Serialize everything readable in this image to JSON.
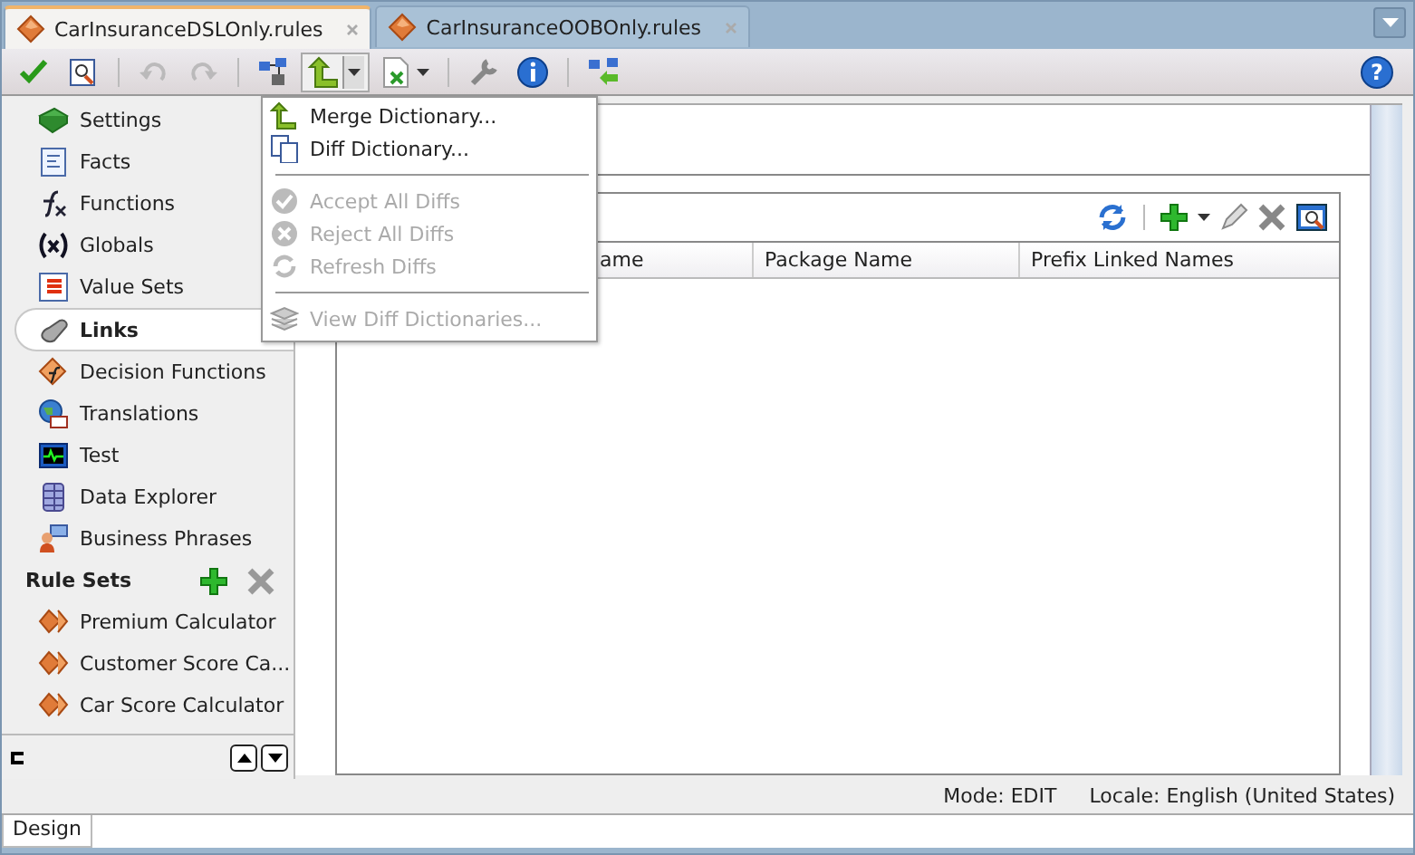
{
  "tabs": [
    {
      "label": "CarInsuranceDSLOnly.rules",
      "selected": true
    },
    {
      "label": "CarInsuranceOOBOnly.rules",
      "selected": false
    }
  ],
  "toolbar": [
    {
      "kind": "check"
    },
    {
      "kind": "preview"
    },
    {
      "kind": "sep"
    },
    {
      "kind": "undo",
      "disabled": true
    },
    {
      "kind": "redo",
      "disabled": true
    },
    {
      "kind": "sep"
    },
    {
      "kind": "link"
    },
    {
      "kind": "merge",
      "pressed": true
    },
    {
      "kind": "export"
    },
    {
      "kind": "sep"
    },
    {
      "kind": "wrench"
    },
    {
      "kind": "info"
    },
    {
      "kind": "sep"
    },
    {
      "kind": "linkback"
    }
  ],
  "sidebar": {
    "items": [
      {
        "label": "Settings",
        "selected": false
      },
      {
        "label": "Facts",
        "selected": false
      },
      {
        "label": "Functions",
        "selected": false
      },
      {
        "label": "Globals",
        "selected": false
      },
      {
        "label": "Value Sets",
        "selected": false
      },
      {
        "label": "Links",
        "selected": true
      },
      {
        "label": "Decision Functions",
        "selected": false
      },
      {
        "label": "Translations",
        "selected": false
      },
      {
        "label": "Test",
        "selected": false
      },
      {
        "label": "Data Explorer",
        "selected": false
      },
      {
        "label": "Business Phrases",
        "selected": false
      }
    ],
    "section_title": "Rule Sets",
    "rule_sets": [
      {
        "label": "Premium Calculator"
      },
      {
        "label": "Customer Score Ca..."
      },
      {
        "label": "Car Score Calculator"
      }
    ]
  },
  "table": {
    "columns": [
      "ame",
      "Package Name",
      "Prefix Linked Names"
    ]
  },
  "menu": [
    {
      "kind": "item",
      "label": "Merge Dictionary...",
      "disabled": false
    },
    {
      "kind": "item",
      "label": "Diff Dictionary...",
      "disabled": false
    },
    {
      "kind": "separator"
    },
    {
      "kind": "item",
      "label": "Accept All Diffs",
      "disabled": true
    },
    {
      "kind": "item",
      "label": "Reject All Diffs",
      "disabled": true
    },
    {
      "kind": "item",
      "label": "Refresh Diffs",
      "disabled": true
    },
    {
      "kind": "separator"
    },
    {
      "kind": "item",
      "label": "View Diff Dictionaries...",
      "disabled": true
    }
  ],
  "help_button": "?",
  "status_bar": {
    "mode": "Mode: EDIT",
    "locale": "Locale: English (United States)"
  },
  "bottom_tabs": [
    {
      "label": "Design",
      "selected": true
    }
  ]
}
